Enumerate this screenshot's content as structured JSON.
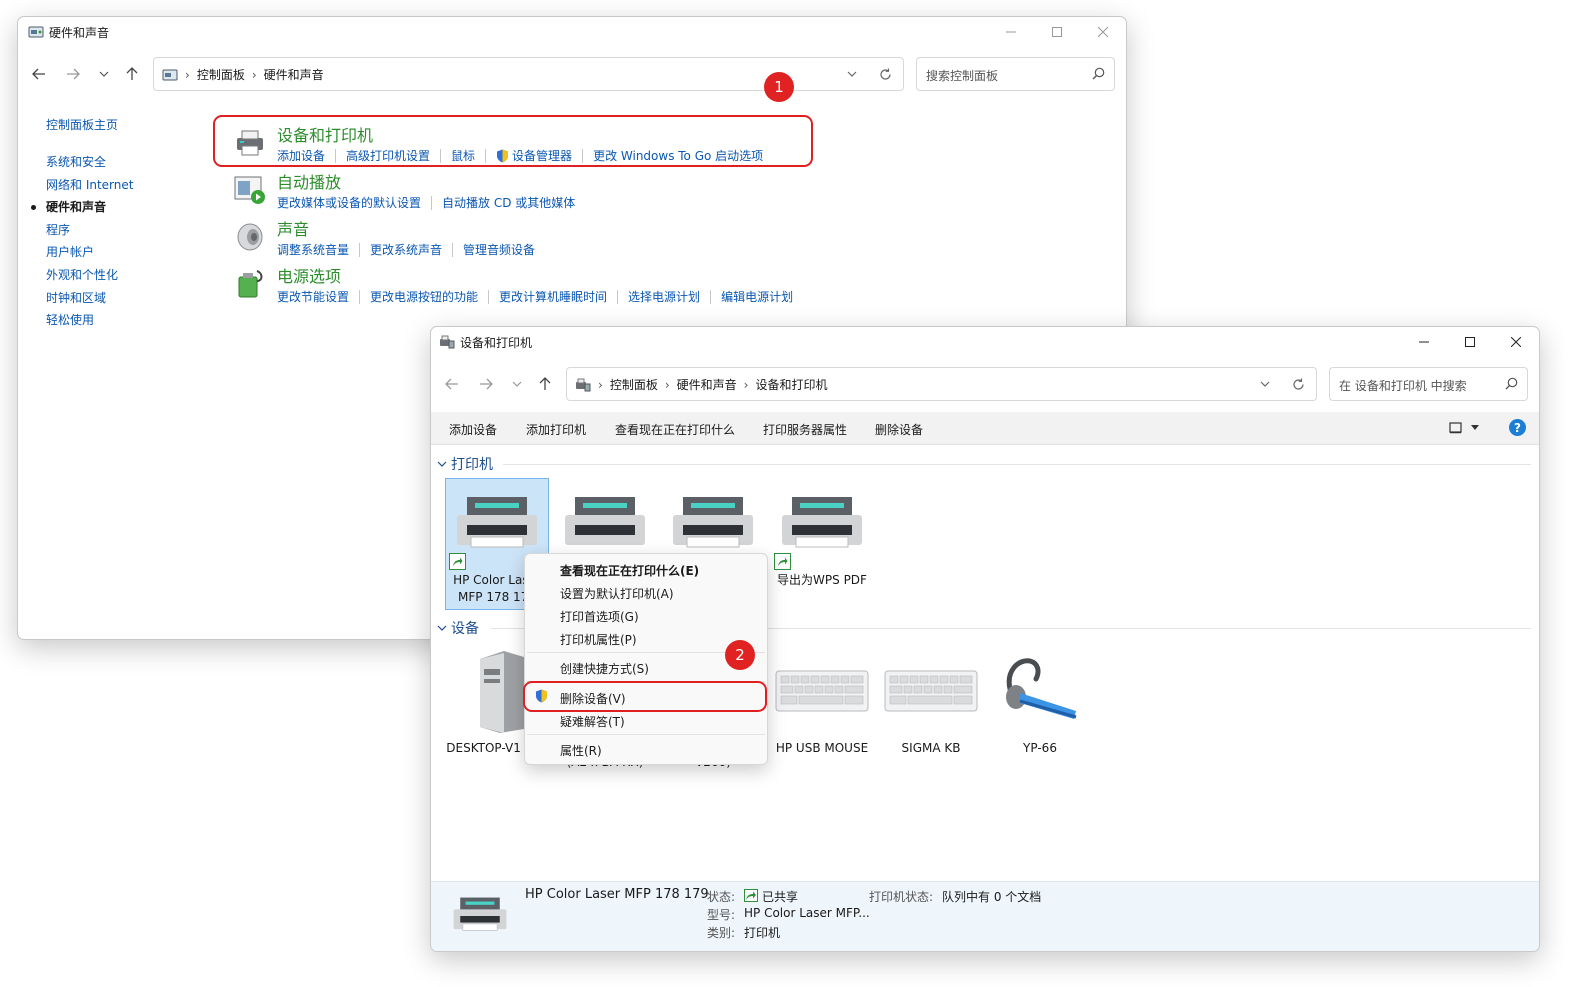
{
  "control_panel": {
    "title": "硬件和声音",
    "breadcrumb": [
      "控制面板",
      "硬件和声音"
    ],
    "search_placeholder": "搜索控制面板",
    "left_nav": {
      "home": "控制面板主页",
      "items": [
        "系统和安全",
        "网络和 Internet",
        "硬件和声音",
        "程序",
        "用户帐户",
        "外观和个性化",
        "时钟和区域",
        "轻松使用"
      ],
      "active_index": 2
    },
    "categories": [
      {
        "title": "设备和打印机",
        "icon": "printer-icon",
        "links": [
          "添加设备",
          "高级打印机设置",
          "鼠标",
          "设备管理器",
          "更改 Windows To Go 启动选项"
        ]
      },
      {
        "title": "自动播放",
        "icon": "autoplay-icon",
        "links": [
          "更改媒体或设备的默认设置",
          "自动播放 CD 或其他媒体"
        ]
      },
      {
        "title": "声音",
        "icon": "speaker-icon",
        "links": [
          "调整系统音量",
          "更改系统声音",
          "管理音频设备"
        ]
      },
      {
        "title": "电源选项",
        "icon": "power-icon",
        "links": [
          "更改节能设置",
          "更改电源按钮的功能",
          "更改计算机睡眠时间",
          "选择电源计划",
          "编辑电源计划"
        ]
      }
    ],
    "badge": "1"
  },
  "devices": {
    "title": "设备和打印机",
    "breadcrumb": [
      "控制面板",
      "硬件和声音",
      "设备和打印机"
    ],
    "search_placeholder": "在 设备和打印机 中搜索",
    "toolbar": [
      "添加设备",
      "添加打印机",
      "查看现在正在打印什么",
      "打印服务器属性",
      "删除设备"
    ],
    "printers_header": "打印机",
    "printers": [
      {
        "label": "HP Color Laser MFP 178 179"
      },
      {
        "label": ""
      },
      {
        "label": ""
      },
      {
        "label": "导出为WPS PDF"
      }
    ],
    "devices_header": "设备",
    "devices": [
      {
        "label": "DESKTOP-V1 UEL"
      },
      {
        "label": "Monitor (A24FBA-RX)"
      },
      {
        "label": "Monitor (DP2VGA V260)"
      },
      {
        "label": "HP USB MOUSE"
      },
      {
        "label": "SIGMA KB"
      },
      {
        "label": "YP-66"
      }
    ],
    "context_menu": {
      "items": [
        "查看现在正在打印什么(E)",
        "设置为默认打印机(A)",
        "打印首选项(G)",
        "打印机属性(P)",
        "创建快捷方式(S)",
        "删除设备(V)",
        "疑难解答(T)",
        "属性(R)"
      ]
    },
    "badge": "2",
    "status": {
      "device_name": "HP Color Laser MFP 178 179",
      "state_label": "状态:",
      "state_value": "已共享",
      "model_label": "型号:",
      "model_value": "HP Color Laser MFP...",
      "category_label": "类别:",
      "category_value": "打印机",
      "printer_status_label": "打印机状态:",
      "printer_status_value": "队列中有 0 个文档"
    }
  },
  "colors": {
    "link": "#0b57b2",
    "category_title": "#2d8d2d",
    "highlight": "#e02020",
    "selection": "#cce4f7"
  }
}
